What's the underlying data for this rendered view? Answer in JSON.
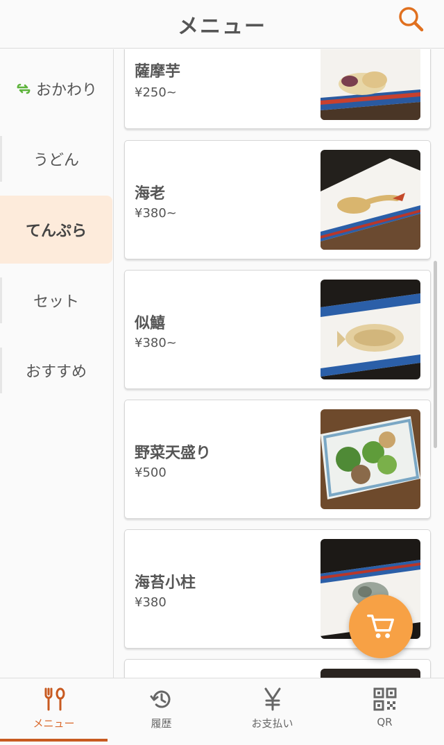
{
  "header": {
    "title": "メニュー"
  },
  "sidebar": {
    "items": [
      {
        "label": "おかわり",
        "icon": "refresh-icon",
        "active": false
      },
      {
        "label": "うどん",
        "active": false
      },
      {
        "label": "てんぷら",
        "active": true
      },
      {
        "label": "セット",
        "active": false
      },
      {
        "label": "おすすめ",
        "active": false
      }
    ]
  },
  "menu_items": [
    {
      "name": "薩摩芋",
      "price": "¥250~"
    },
    {
      "name": "海老",
      "price": "¥380~"
    },
    {
      "name": "似鱚",
      "price": "¥380~"
    },
    {
      "name": "野菜天盛り",
      "price": "¥500"
    },
    {
      "name": "海苔小柱",
      "price": "¥380"
    },
    {
      "name": "",
      "price": ""
    }
  ],
  "bottom_nav": {
    "items": [
      {
        "label": "メニュー",
        "icon": "fork-knife-icon",
        "active": true
      },
      {
        "label": "履歴",
        "icon": "history-icon",
        "active": false
      },
      {
        "label": "お支払い",
        "icon": "yen-icon",
        "active": false
      },
      {
        "label": "QR",
        "icon": "qr-code-icon",
        "active": false
      }
    ]
  },
  "colors": {
    "accent": "#f7a145",
    "active_nav": "#d9682b",
    "active_category_bg": "#fdebdb",
    "refresh_icon": "#5db33b"
  }
}
